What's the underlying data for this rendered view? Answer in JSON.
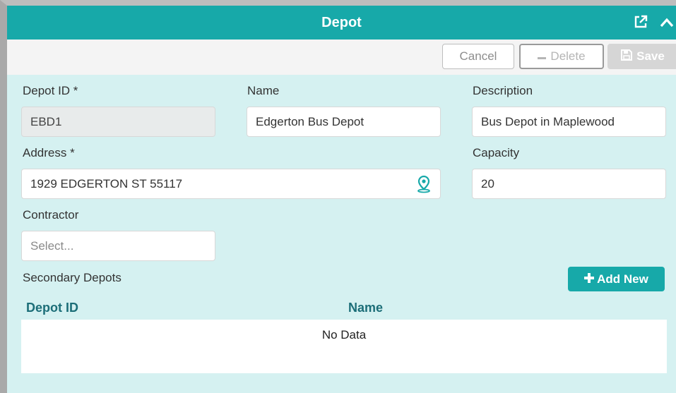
{
  "header": {
    "title": "Depot",
    "popout_icon": "external-link-icon",
    "collapse_icon": "chevron-up-icon"
  },
  "toolbar": {
    "cancel_label": "Cancel",
    "delete_label": "Delete",
    "save_label": "Save",
    "delete_icon": "minus-icon",
    "save_icon": "floppy-disk-icon"
  },
  "form": {
    "depot_id": {
      "label": "Depot ID *",
      "value": "EBD1"
    },
    "name": {
      "label": "Name",
      "value": "Edgerton Bus Depot"
    },
    "description": {
      "label": "Description",
      "value": "Bus Depot in Maplewood"
    },
    "address": {
      "label": "Address *",
      "value": "1929 EDGERTON ST 55117",
      "icon": "map-pin-icon"
    },
    "capacity": {
      "label": "Capacity",
      "value": "20"
    },
    "contractor": {
      "label": "Contractor",
      "placeholder": "Select..."
    }
  },
  "secondary": {
    "label": "Secondary Depots",
    "add_label": "Add New",
    "add_icon": "plus-icon",
    "columns": [
      "Depot ID",
      "Name"
    ],
    "empty_text": "No Data"
  },
  "colors": {
    "accent": "#17a9a9",
    "panel_bg": "#d5f1f1",
    "header_text": "#1c6e78"
  }
}
